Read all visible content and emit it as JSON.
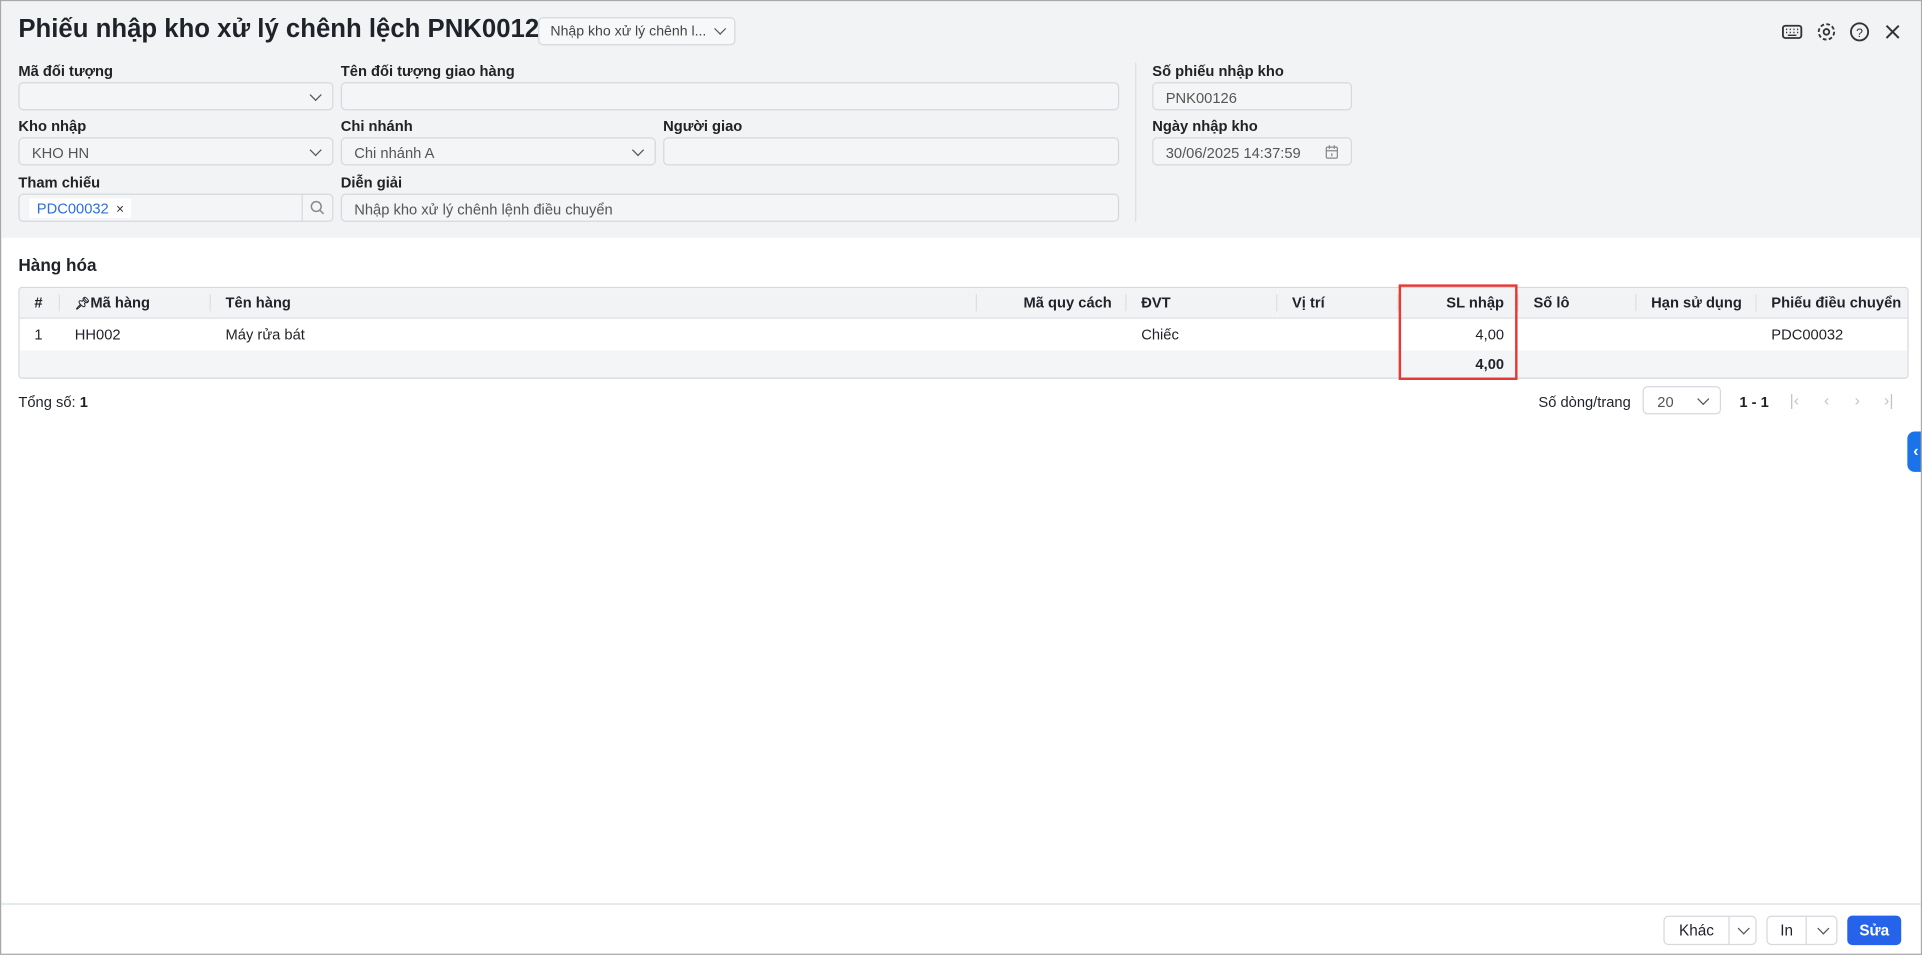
{
  "header": {
    "title": "Phiếu nhập kho xử lý chênh lệch PNK00126",
    "type_select": "Nhập kho xử lý chênh l..."
  },
  "icons": [
    "keyboard-icon",
    "gear-icon",
    "help-icon",
    "close-icon"
  ],
  "form": {
    "ma_doi_tuong": {
      "label": "Mã đối tượng",
      "value": ""
    },
    "ten_doi_tuong": {
      "label": "Tên đối tượng giao hàng",
      "value": ""
    },
    "kho_nhap": {
      "label": "Kho nhập",
      "value": "KHO HN"
    },
    "chi_nhanh": {
      "label": "Chi nhánh",
      "value": "Chi nhánh A"
    },
    "nguoi_giao": {
      "label": "Người giao",
      "value": ""
    },
    "tham_chieu": {
      "label": "Tham chiếu",
      "tag": "PDC00032",
      "remove": "×"
    },
    "dien_giai": {
      "label": "Diễn giải",
      "value": "Nhập kho xử lý chênh lệnh điều chuyển"
    },
    "so_phieu": {
      "label": "Số phiếu nhập kho",
      "value": "PNK00126"
    },
    "ngay_nhap": {
      "label": "Ngày nhập kho",
      "value": "30/06/2025 14:37:59"
    }
  },
  "goods": {
    "title": "Hàng hóa",
    "columns": [
      "#",
      "Mã hàng",
      "Tên hàng",
      "Mã quy cách",
      "ĐVT",
      "Vị trí",
      "SL nhập",
      "Số lô",
      "Hạn sử dụng",
      "Phiếu điều chuyển"
    ],
    "rows": [
      {
        "no": "1",
        "code": "HH002",
        "name": "Máy rửa bát",
        "spec": "",
        "unit": "Chiếc",
        "location": "",
        "qty": "4,00",
        "lot": "",
        "expiry": "",
        "transfer": "PDC00032"
      }
    ],
    "total_qty": "4,00"
  },
  "footer": {
    "total_label": "Tổng số:",
    "total": "1",
    "rows_per_page_label": "Số dòng/trang",
    "rows_per_page": "20",
    "range": "1 - 1"
  },
  "actions": {
    "other": "Khác",
    "print": "In",
    "edit": "Sửa"
  },
  "colors": {
    "primary": "#2563eb",
    "highlight": "#e53935"
  }
}
